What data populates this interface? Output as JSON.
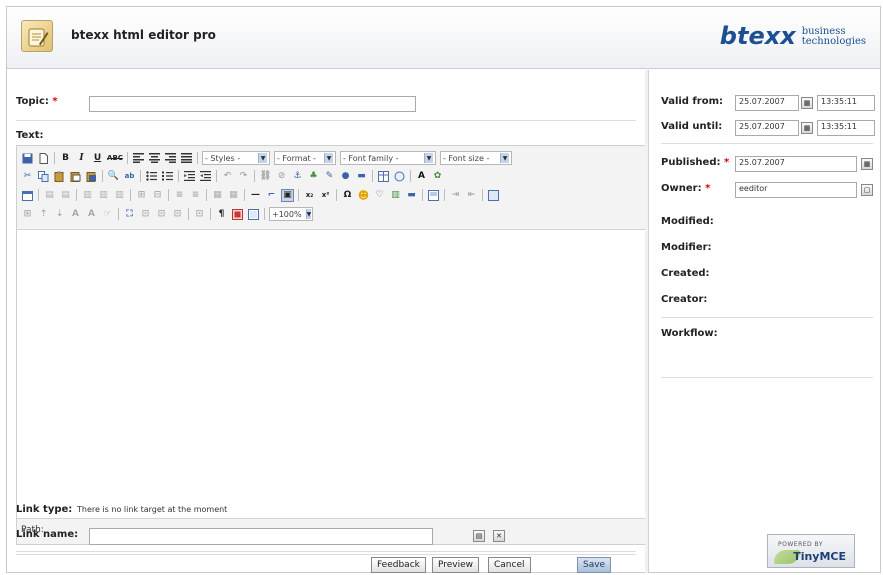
{
  "header": {
    "app_title": "btexx html editor pro",
    "brand_word": "btexx",
    "brand_tag_line1": "business",
    "brand_tag_line2": "technologies"
  },
  "form": {
    "topic_label": "Topic:",
    "required_mark": "*",
    "topic_value": "",
    "text_label": "Text:",
    "link_type_label": "Link type:",
    "link_type_value": "There is no link target at the moment",
    "link_name_label": "Link name:",
    "link_name_value": ""
  },
  "toolbar": {
    "styles_label": "- Styles -",
    "format_label": "- Format -",
    "font_family_label": "- Font family -",
    "font_size_label": "- Font size -",
    "zoom_label": "+100%",
    "bold": "B",
    "italic": "I",
    "underline": "U",
    "strike": "ABC",
    "omega": "Ω",
    "pilcrow": "¶",
    "hr": "—",
    "sub": "x₂",
    "sup": "x²",
    "font_color": "A",
    "text_a": "A"
  },
  "editor": {
    "path_label": "Path:"
  },
  "buttons": {
    "feedback": "Feedback",
    "preview": "Preview",
    "cancel": "Cancel",
    "save": "Save"
  },
  "side": {
    "valid_from_label": "Valid from:",
    "valid_from_date": "25.07.2007",
    "valid_from_time": "13:35:11",
    "valid_until_label": "Valid until:",
    "valid_until_date": "25.07.2007",
    "valid_until_time": "13:35:11",
    "published_label": "Published:",
    "published_value": "25.07.2007",
    "owner_label": "Owner:",
    "owner_value": "eeditor",
    "modified_label": "Modified:",
    "modifier_label": "Modifier:",
    "created_label": "Created:",
    "creator_label": "Creator:",
    "workflow_label": "Workflow:",
    "powered_small": "POWERED BY",
    "powered_big": "TinyMCE"
  },
  "colors": {
    "brand_blue": "#1e4f93",
    "required_red": "#dd0000",
    "save_button": "#a9bfdb"
  }
}
